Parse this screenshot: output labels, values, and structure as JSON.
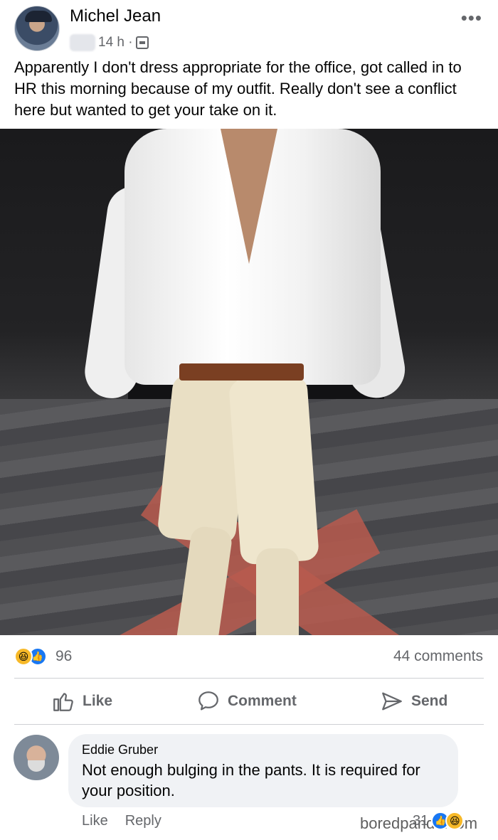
{
  "post": {
    "author": "Michel Jean",
    "time": "14 h ·",
    "text": "Apparently I don't dress appropriate for the office, got called in to HR this morning because of my outfit. Really don't see a conflict here but wanted to get your take on it.",
    "reactions_count": "96",
    "comments_count": "44 comments",
    "reaction_types": [
      "haha-icon",
      "like-icon"
    ]
  },
  "actions": {
    "like": "Like",
    "comment": "Comment",
    "send": "Send"
  },
  "comment": {
    "author": "Eddie Gruber",
    "text": "Not enough bulging in the pants. It is required for your position.",
    "like": "Like",
    "reply": "Reply",
    "reactions_count": "31"
  },
  "watermark": "boredpanda.com",
  "colors": {
    "facebook_blue": "#1877f2",
    "haha_yellow": "#f7b928",
    "secondary_text": "#65676b",
    "comment_bubble": "#f0f2f5"
  }
}
